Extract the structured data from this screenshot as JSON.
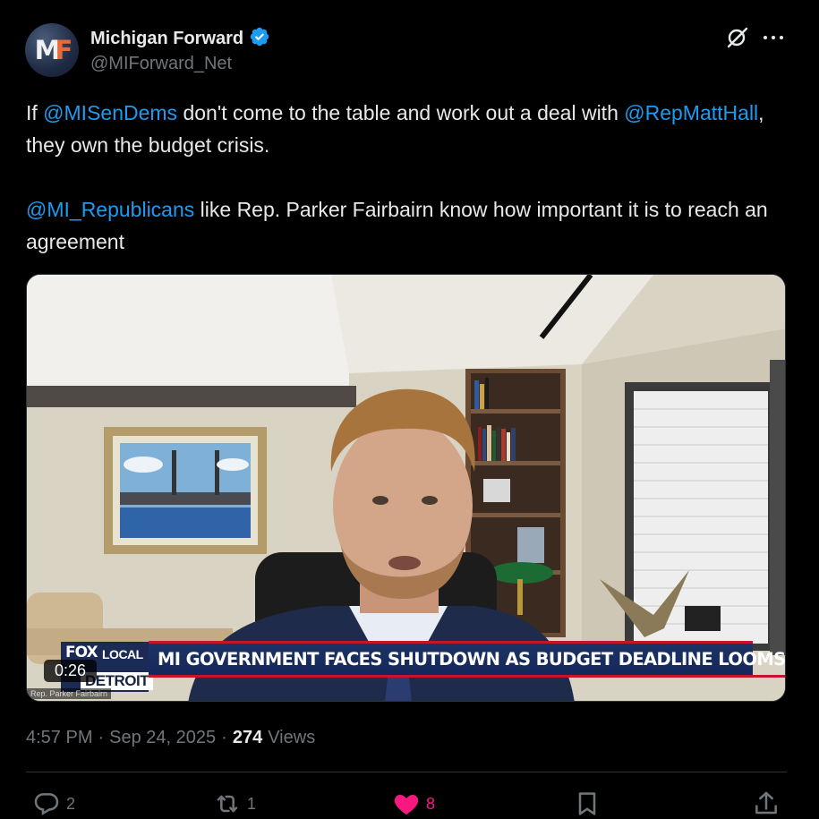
{
  "author": {
    "display_name": "Michigan Forward",
    "handle": "@MIForward_Net",
    "verified": true,
    "avatar_letters": [
      "M",
      "F"
    ]
  },
  "tweet": {
    "paragraph1": [
      {
        "text": "If ",
        "mention": false
      },
      {
        "text": "@MISenDems",
        "mention": true
      },
      {
        "text": " don't come to the table and work out a deal with ",
        "mention": false
      },
      {
        "text": "@RepMattHall",
        "mention": true
      },
      {
        "text": ", they own the budget crisis.",
        "mention": false
      }
    ],
    "paragraph2": [
      {
        "text": "@MI_Republicans",
        "mention": true
      },
      {
        "text": " like Rep. Parker Fairbairn know how important it is to reach an agreement",
        "mention": false
      }
    ]
  },
  "video": {
    "duration": "0:26",
    "chyron_brand_fox": "FOX",
    "chyron_brand_local": "LOCAL",
    "chyron_brand_city": "DETROIT",
    "headline": "MI GOVERNMENT FACES SHUTDOWN AS BUDGET DEADLINE LOOMS",
    "speaker_tag": "Rep. Parker Fairbairn"
  },
  "meta": {
    "time": "4:57 PM",
    "date": "Sep 24, 2025",
    "views_count": "274",
    "views_label": "Views"
  },
  "actions": {
    "replies": "2",
    "reposts": "1",
    "likes": "8",
    "liked": true
  },
  "colors": {
    "background": "#000000",
    "text": "#e7e9ea",
    "muted": "#71767b",
    "link": "#1d9bf0",
    "like": "#f91880",
    "verified": "#1d9bf0",
    "chyron_blue": "#1d3366",
    "chyron_red": "#c7132c"
  },
  "icons": [
    "verified-badge-icon",
    "grok-icon",
    "more-icon",
    "reply-icon",
    "retweet-icon",
    "heart-icon",
    "bookmark-icon",
    "share-icon"
  ]
}
